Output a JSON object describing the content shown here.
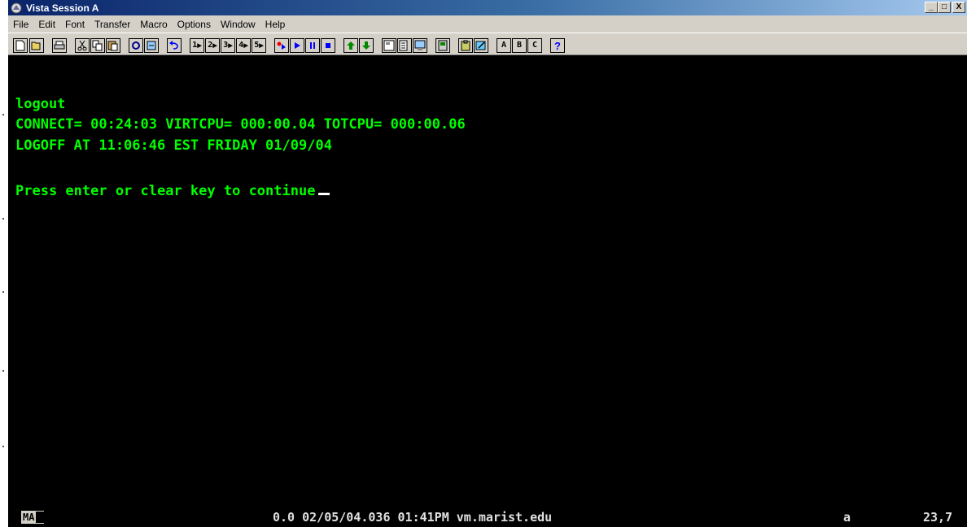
{
  "window": {
    "title": "Vista Session A",
    "controls": {
      "minimize": "_",
      "maximize": "□",
      "close": "X"
    }
  },
  "menu": [
    "File",
    "Edit",
    "Font",
    "Transfer",
    "Macro",
    "Options",
    "Window",
    "Help"
  ],
  "toolbar": {
    "macro_numbers": [
      "1",
      "2",
      "3",
      "4",
      "5"
    ],
    "letter_buttons": [
      "A",
      "B",
      "C"
    ],
    "help_label": "?"
  },
  "terminal": {
    "lines": [
      "logout",
      "CONNECT= 00:24:03 VIRTCPU= 000:00.04 TOTCPU= 000:00.06",
      "LOGOFF AT 11:06:46 EST FRIDAY 01/09/04",
      "",
      "Press enter or clear key to continue"
    ],
    "text_color": "#00ff00",
    "background": "#000000"
  },
  "status": {
    "mode": "MA",
    "session_info": "0.0 02/05/04.036 01:41PM vm.marist.edu",
    "session_letter": "a",
    "cursor_position": "23,7"
  }
}
